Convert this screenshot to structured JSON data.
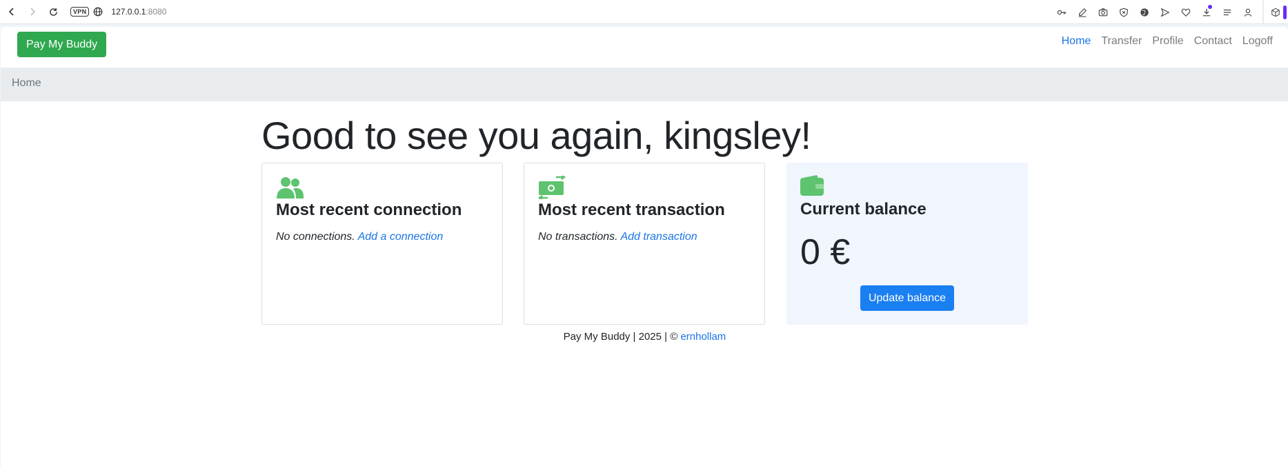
{
  "browser": {
    "url_host": "127.0.0.1",
    "url_port": ":8080",
    "vpn_label": "VPN"
  },
  "navbar": {
    "brand": "Pay My Buddy",
    "links": [
      {
        "label": "Home",
        "active": true
      },
      {
        "label": "Transfer",
        "active": false
      },
      {
        "label": "Profile",
        "active": false
      },
      {
        "label": "Contact",
        "active": false
      },
      {
        "label": "Logoff",
        "active": false
      }
    ]
  },
  "breadcrumb": "Home",
  "greeting": "Good to see you again, kingsley!",
  "cards": {
    "connection": {
      "title": "Most recent connection",
      "empty_text": "No connections.",
      "link": "Add a connection",
      "icon": "users-icon"
    },
    "transaction": {
      "title": "Most recent transaction",
      "empty_text": "No transactions.",
      "link": "Add transaction",
      "icon": "money-transfer-icon"
    },
    "balance": {
      "title": "Current balance",
      "amount": "0 €",
      "button": "Update balance",
      "icon": "wallet-icon"
    }
  },
  "footer": {
    "text": "Pay My Buddy | 2025 | ©",
    "author": "ernhollam"
  },
  "colors": {
    "brand_green": "#2fa84f",
    "icon_green": "#5ec36f",
    "link_blue": "#1a73e8",
    "button_blue": "#1a7ff0"
  }
}
